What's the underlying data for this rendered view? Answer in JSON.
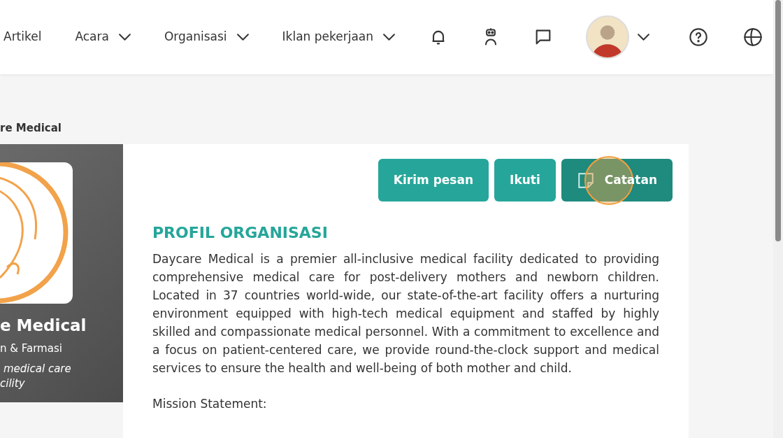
{
  "nav": {
    "items": [
      {
        "label": "Artikel",
        "dropdown": false
      },
      {
        "label": "Acara",
        "dropdown": true
      },
      {
        "label": "Organisasi",
        "dropdown": true
      },
      {
        "label": "Iklan pekerjaan",
        "dropdown": true
      }
    ]
  },
  "breadcrumb": "re Medical",
  "org_card": {
    "name": "e Medical",
    "category": "n & Farmasi",
    "tagline_lines": [
      "medical care",
      "cility"
    ]
  },
  "actions": [
    {
      "label": "Kirim pesan",
      "kind": "plain",
      "hovered": false
    },
    {
      "label": "Ikuti",
      "kind": "plain",
      "hovered": false
    },
    {
      "label": "Catatan",
      "kind": "note",
      "hovered": true
    }
  ],
  "profile": {
    "heading": "PROFIL ORGANISASI",
    "description": "Daycare Medical is a premier all-inclusive medical facility dedicated to providing comprehensive medical care for post-delivery mothers and newborn children. Located in 37 countries world-wide, our state-of-the-art facility offers a nurturing environment equipped with high-tech medical equipment and staffed by highly skilled and compassionate medical personnel. With a commitment to excellence and a focus on patient-centered care, we provide round-the-clock support and medical services to ensure the health and well-being of both mother and child.",
    "mission_label": "Mission Statement:"
  }
}
